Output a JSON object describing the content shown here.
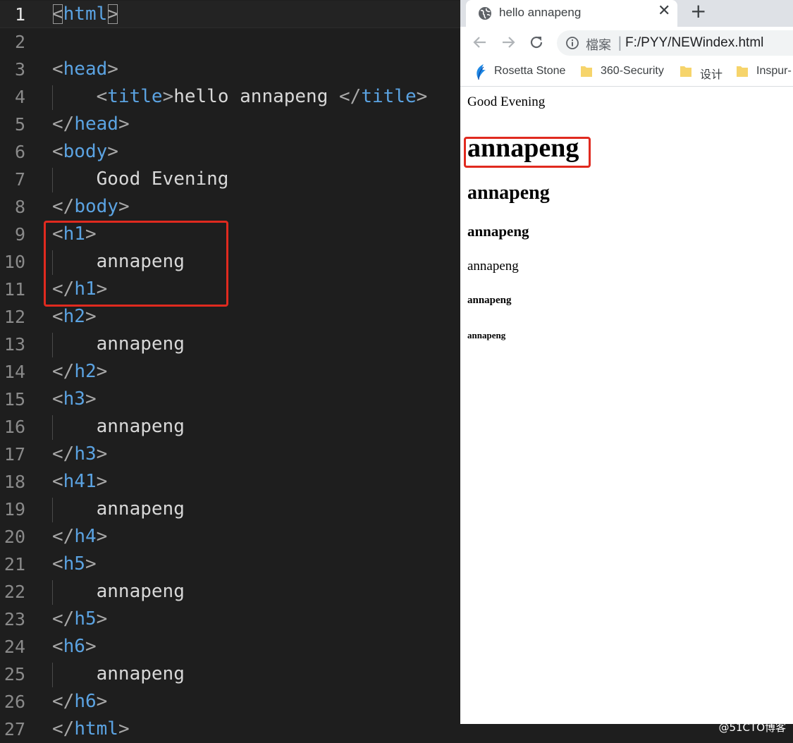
{
  "editor": {
    "lines": [
      {
        "n": "1",
        "segs": [
          [
            "p",
            "<"
          ],
          [
            "t",
            "html"
          ],
          [
            "p",
            ">"
          ]
        ],
        "indent": 0,
        "current": true
      },
      {
        "n": "2",
        "segs": [],
        "indent": 0
      },
      {
        "n": "3",
        "segs": [
          [
            "p",
            "<"
          ],
          [
            "t",
            "head"
          ],
          [
            "p",
            ">"
          ]
        ],
        "indent": 0
      },
      {
        "n": "4",
        "segs": [
          [
            "p",
            "<"
          ],
          [
            "t",
            "title"
          ],
          [
            "p",
            ">"
          ],
          [
            "x",
            "hello annapeng "
          ],
          [
            "p",
            "</"
          ],
          [
            "t",
            "title"
          ],
          [
            "p",
            ">"
          ]
        ],
        "indent": 1
      },
      {
        "n": "5",
        "segs": [
          [
            "p",
            "</"
          ],
          [
            "t",
            "head"
          ],
          [
            "p",
            ">"
          ]
        ],
        "indent": 0
      },
      {
        "n": "6",
        "segs": [
          [
            "p",
            "<"
          ],
          [
            "t",
            "body"
          ],
          [
            "p",
            ">"
          ]
        ],
        "indent": 0
      },
      {
        "n": "7",
        "segs": [
          [
            "x",
            "Good Evening"
          ]
        ],
        "indent": 1
      },
      {
        "n": "8",
        "segs": [
          [
            "p",
            "</"
          ],
          [
            "t",
            "body"
          ],
          [
            "p",
            ">"
          ]
        ],
        "indent": 0
      },
      {
        "n": "9",
        "segs": [
          [
            "p",
            "<"
          ],
          [
            "t",
            "h1"
          ],
          [
            "p",
            ">"
          ]
        ],
        "indent": 0
      },
      {
        "n": "10",
        "segs": [
          [
            "x",
            "annapeng"
          ]
        ],
        "indent": 1
      },
      {
        "n": "11",
        "segs": [
          [
            "p",
            "</"
          ],
          [
            "t",
            "h1"
          ],
          [
            "p",
            ">"
          ]
        ],
        "indent": 0
      },
      {
        "n": "12",
        "segs": [
          [
            "p",
            "<"
          ],
          [
            "t",
            "h2"
          ],
          [
            "p",
            ">"
          ]
        ],
        "indent": 0
      },
      {
        "n": "13",
        "segs": [
          [
            "x",
            "annapeng"
          ]
        ],
        "indent": 1
      },
      {
        "n": "14",
        "segs": [
          [
            "p",
            "</"
          ],
          [
            "t",
            "h2"
          ],
          [
            "p",
            ">"
          ]
        ],
        "indent": 0
      },
      {
        "n": "15",
        "segs": [
          [
            "p",
            "<"
          ],
          [
            "t",
            "h3"
          ],
          [
            "p",
            ">"
          ]
        ],
        "indent": 0
      },
      {
        "n": "16",
        "segs": [
          [
            "x",
            "annapeng"
          ]
        ],
        "indent": 1
      },
      {
        "n": "17",
        "segs": [
          [
            "p",
            "</"
          ],
          [
            "t",
            "h3"
          ],
          [
            "p",
            ">"
          ]
        ],
        "indent": 0
      },
      {
        "n": "18",
        "segs": [
          [
            "p",
            "<"
          ],
          [
            "t",
            "h41"
          ],
          [
            "p",
            ">"
          ]
        ],
        "indent": 0
      },
      {
        "n": "19",
        "segs": [
          [
            "x",
            "annapeng"
          ]
        ],
        "indent": 1
      },
      {
        "n": "20",
        "segs": [
          [
            "p",
            "</"
          ],
          [
            "t",
            "h4"
          ],
          [
            "p",
            ">"
          ]
        ],
        "indent": 0
      },
      {
        "n": "21",
        "segs": [
          [
            "p",
            "<"
          ],
          [
            "t",
            "h5"
          ],
          [
            "p",
            ">"
          ]
        ],
        "indent": 0
      },
      {
        "n": "22",
        "segs": [
          [
            "x",
            "annapeng"
          ]
        ],
        "indent": 1
      },
      {
        "n": "23",
        "segs": [
          [
            "p",
            "</"
          ],
          [
            "t",
            "h5"
          ],
          [
            "p",
            ">"
          ]
        ],
        "indent": 0
      },
      {
        "n": "24",
        "segs": [
          [
            "p",
            "<"
          ],
          [
            "t",
            "h6"
          ],
          [
            "p",
            ">"
          ]
        ],
        "indent": 0
      },
      {
        "n": "25",
        "segs": [
          [
            "x",
            "annapeng"
          ]
        ],
        "indent": 1
      },
      {
        "n": "26",
        "segs": [
          [
            "p",
            "</"
          ],
          [
            "t",
            "h6"
          ],
          [
            "p",
            ">"
          ]
        ],
        "indent": 0
      },
      {
        "n": "27",
        "segs": [
          [
            "p",
            "</"
          ],
          [
            "t",
            "html"
          ],
          [
            "p",
            ">"
          ]
        ],
        "indent": 0
      }
    ]
  },
  "browser": {
    "tab": {
      "title": "hello annapeng",
      "close": "✕",
      "icon": "globe-icon"
    },
    "new_tab": "+",
    "toolbar": {
      "back_icon": "arrow-left-icon",
      "forward_icon": "arrow-right-icon",
      "reload_icon": "reload-icon"
    },
    "address": {
      "info_icon": "info-icon",
      "label": "檔案",
      "separator": "|",
      "url": "F:/PYY/NEWindex.html"
    },
    "bookmarks": [
      {
        "label": "Rosetta Stone",
        "icon": "rosetta-stone-icon"
      },
      {
        "label": "360-Security",
        "icon": "folder-icon"
      },
      {
        "label": "设计",
        "icon": "folder-icon"
      },
      {
        "label": "Inspur-",
        "icon": "folder-icon"
      }
    ],
    "content": {
      "body_text": "Good Evening",
      "h1": "annapeng",
      "h2": "annapeng",
      "h3": "annapeng",
      "h4": "annapeng",
      "h5": "annapeng",
      "h6": "annapeng"
    }
  },
  "watermark": "@51CTO博客",
  "colors": {
    "tag": "#5ba3e2",
    "punct": "#a8a8a8",
    "text": "#d8d8d8",
    "highlight_box": "#e02a1f"
  }
}
